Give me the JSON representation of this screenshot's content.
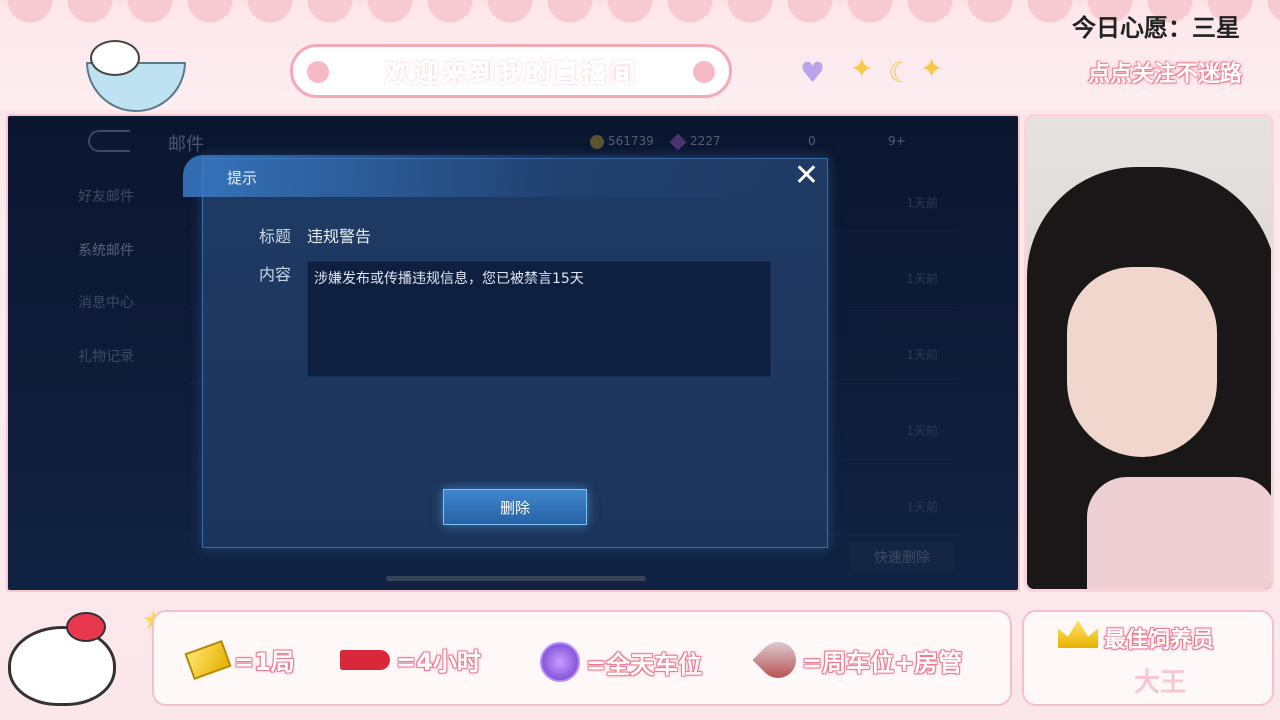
{
  "stream": {
    "banner_title": "欢迎来到我的直播间",
    "wish": "今日心愿：三星",
    "follow": "点点关注不迷路"
  },
  "game": {
    "header": {
      "title": "邮件",
      "coins": "561739",
      "diamonds": "2227",
      "vouchers": "0",
      "extra": "9+"
    },
    "sidebar": [
      {
        "label": "好友邮件"
      },
      {
        "label": "系统邮件"
      },
      {
        "label": "消息中心"
      },
      {
        "label": "礼物记录"
      }
    ],
    "mail_rows": [
      {
        "tag": "1天前"
      },
      {
        "tag": "1天前"
      },
      {
        "tag": "1天前"
      },
      {
        "tag": "1天前"
      },
      {
        "tag": "1天前"
      }
    ],
    "quick_delete": "快速删除",
    "dialog": {
      "title": "提示",
      "close": "✕",
      "subject_label": "标题",
      "subject_value": "违规警告",
      "content_label": "内容",
      "content_value": "涉嫌发布或传播违规信息，您已被禁言15天",
      "delete_button": "删除"
    }
  },
  "rules": [
    {
      "icon": "ticket-icon",
      "text": "=1局"
    },
    {
      "icon": "plane-icon",
      "text": "=4小时"
    },
    {
      "icon": "medal-icon",
      "text": "=全天车位"
    },
    {
      "icon": "rocket-icon",
      "text": "=周车位+房管"
    }
  ],
  "best_feeder": {
    "title": "最佳饲养员",
    "name": "大王"
  },
  "colors": {
    "accent_pink": "#ee7b92",
    "dialog_bg": "#1f3a63",
    "button_blue": "#3f86cc"
  }
}
